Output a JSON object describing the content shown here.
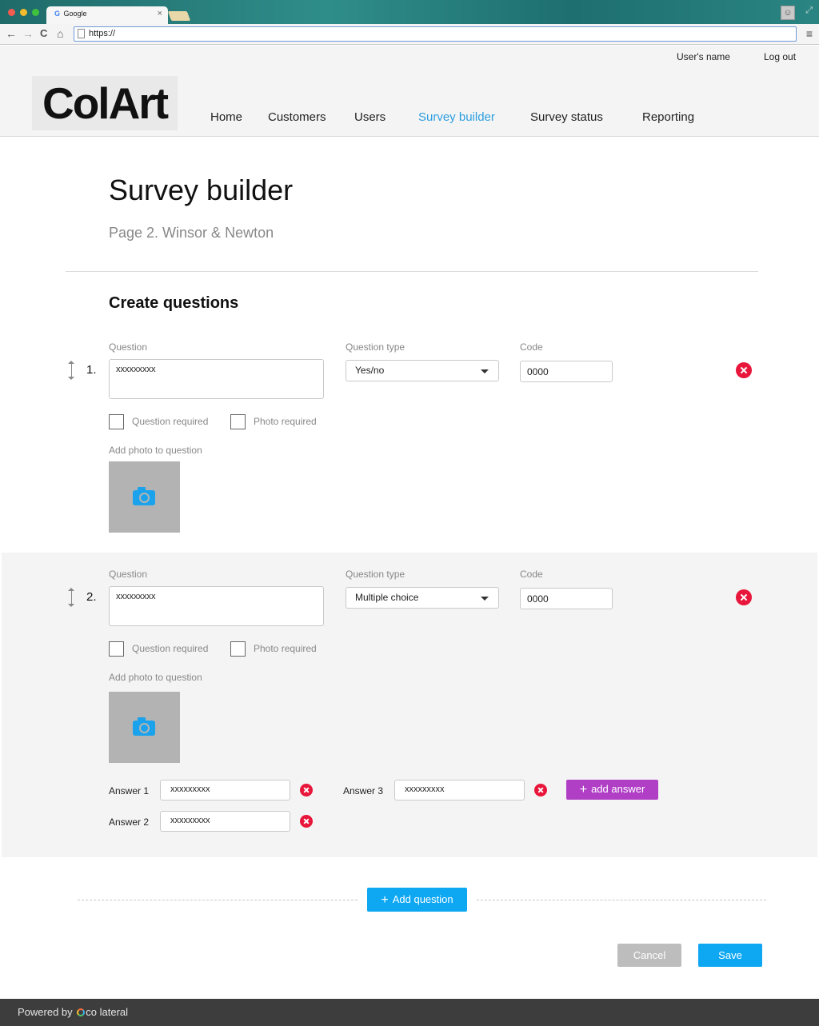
{
  "browser": {
    "tab_title": "Google",
    "tab_logo": "G",
    "tab_close": "×",
    "url": "https://",
    "nav_back": "←",
    "nav_forward": "→",
    "nav_reload": "C",
    "nav_home": "⌂",
    "menu": "≡"
  },
  "header": {
    "logo_text": "ColArt",
    "user_name": "User's name",
    "logout": "Log out",
    "nav": [
      "Home",
      "Customers",
      "Users",
      "Survey builder",
      "Survey status",
      "Reporting"
    ],
    "active_nav": "Survey builder"
  },
  "page": {
    "title": "Survey builder",
    "subtitle": "Page 2. Winsor & Newton",
    "section_title": "Create questions"
  },
  "labels": {
    "question": "Question",
    "question_type": "Question type",
    "code": "Code",
    "question_required": "Question required",
    "photo_required": "Photo required",
    "add_photo": "Add photo to question"
  },
  "questions": [
    {
      "number": "1.",
      "text": "xxxxxxxxx",
      "type": "Yes/no",
      "code": "0000",
      "question_required": false,
      "photo_required": false
    },
    {
      "number": "2.",
      "text": "xxxxxxxxx",
      "type": "Multiple choice",
      "code": "0000",
      "question_required": false,
      "photo_required": false,
      "answers": [
        {
          "label": "Answer 1",
          "value": "xxxxxxxxx"
        },
        {
          "label": "Answer 2",
          "value": "xxxxxxxxx"
        },
        {
          "label": "Answer 3",
          "value": "xxxxxxxxx"
        }
      ],
      "add_answer": "add answer"
    }
  ],
  "actions": {
    "add_question": "Add question",
    "cancel": "Cancel",
    "save": "Save"
  },
  "footer": {
    "powered_by": "Powered by",
    "brand": "co lateral"
  },
  "colors": {
    "accent": "#0ea7f2",
    "active_nav": "#2d9fe0",
    "delete": "#e8163b",
    "add_answer": "#b03fc6",
    "cancel": "#bdbdbd"
  }
}
